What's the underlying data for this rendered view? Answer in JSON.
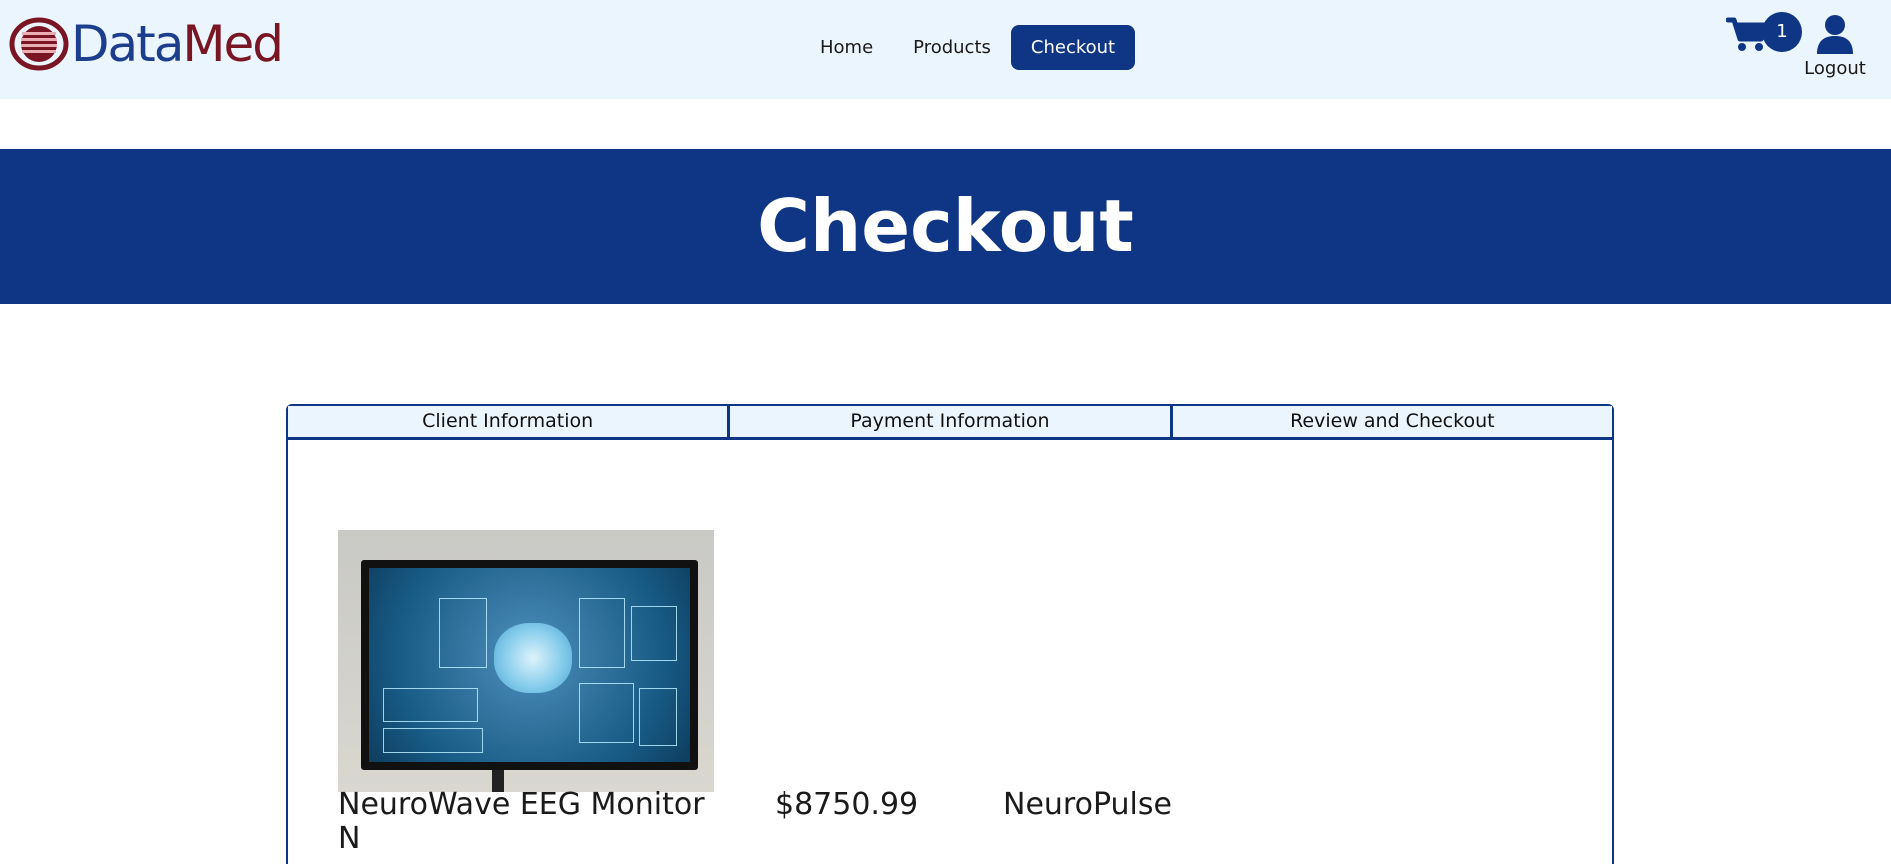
{
  "brand": {
    "name_part1": "Data",
    "name_part2": "Med"
  },
  "nav": {
    "items": [
      {
        "label": "Home"
      },
      {
        "label": "Products"
      },
      {
        "label": "Checkout",
        "active": true
      }
    ]
  },
  "header_actions": {
    "cart_count": "1",
    "logout_label": "Logout"
  },
  "hero": {
    "title": "Checkout"
  },
  "checkout_tabs": [
    {
      "label": "Client Information"
    },
    {
      "label": "Payment Information"
    },
    {
      "label": "Review and Checkout"
    }
  ],
  "product": {
    "name": "NeuroWave EEG Monitor N",
    "price": "$8750.99",
    "brand": "NeuroPulse",
    "image_icon": "medical-monitor-image"
  },
  "colors": {
    "primary": "#0e3685",
    "light_background": "#eaf5fd",
    "brand_red": "#7a1523"
  }
}
